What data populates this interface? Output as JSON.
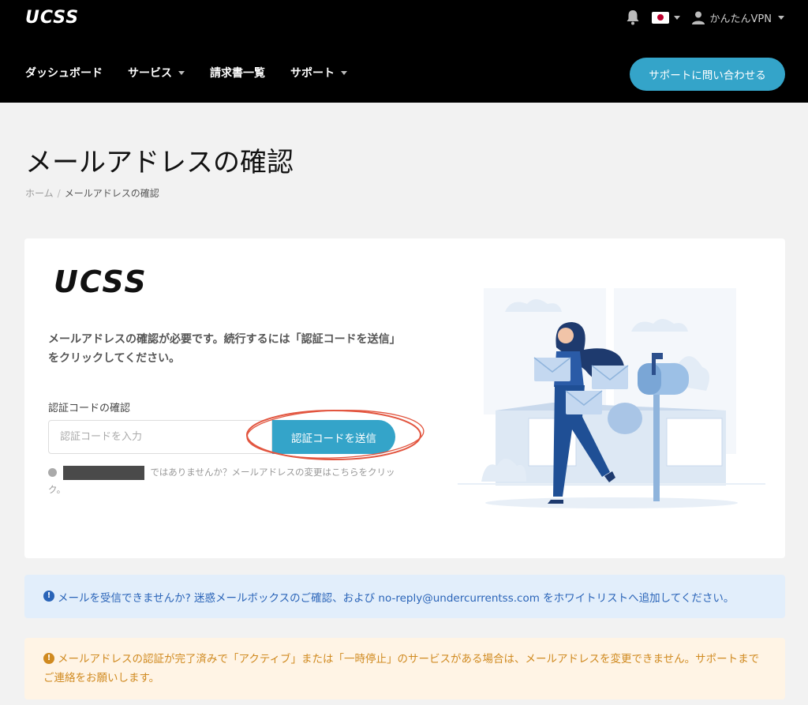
{
  "header": {
    "logo": "UCSS",
    "user_name": "かんたんVPN",
    "nav": [
      {
        "label": "ダッシュボード",
        "dropdown": false
      },
      {
        "label": "サービス",
        "dropdown": true
      },
      {
        "label": "請求書一覧",
        "dropdown": false
      },
      {
        "label": "サポート",
        "dropdown": true
      }
    ],
    "contact_button": "サポートに問い合わせる"
  },
  "page": {
    "title": "メールアドレスの確認",
    "breadcrumb": {
      "home": "ホーム",
      "separator": "/",
      "current": "メールアドレスの確認"
    }
  },
  "card": {
    "logo": "UCSS",
    "description": "メールアドレスの確認が必要です。続行するには「認証コードを送信」をクリックしてください。",
    "field_label": "認証コードの確認",
    "input_placeholder": "認証コードを入力",
    "send_button": "認証コードを送信",
    "change_note": "ではありませんか？メールアドレスの変更はこちらをクリック。"
  },
  "alerts": {
    "info": "メールを受信できませんか? 迷惑メールボックスのご確認、および no-reply@undercurrentss.com をホワイトリストへ追加してください。",
    "warning": "メールアドレスの認証が完了済みで「アクティブ」または「一時停止」のサービスがある場合は、メールアドレスを変更できません。サポートまでご連絡をお願いします。"
  },
  "colors": {
    "accent": "#34a4c9",
    "header_bg": "#000000",
    "info_text": "#2a64b8",
    "warning_text": "#d08a20",
    "annotation_circle": "#e2553f"
  }
}
